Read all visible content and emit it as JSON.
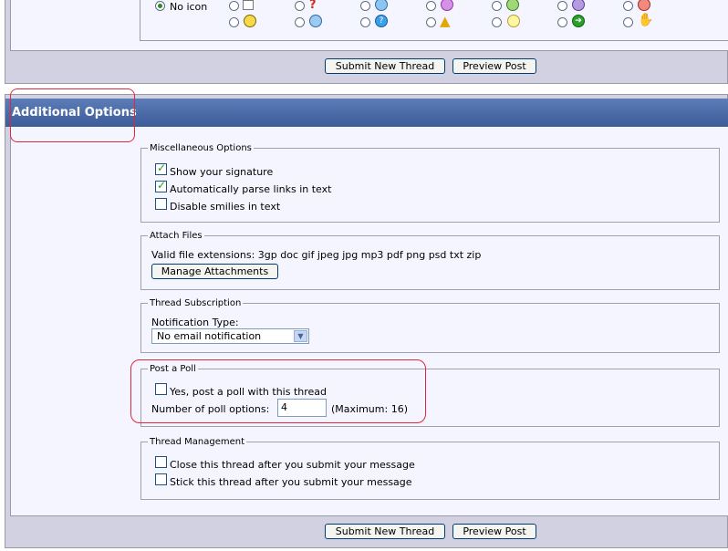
{
  "icons": {
    "no_icon_label": "No icon",
    "symbols": [
      "page-icon",
      "question-icon",
      "smile-icon",
      "grin-icon",
      "globe-icon",
      "sad-icon",
      "angry-icon",
      "happy-icon",
      "cool-icon",
      "question-circle-icon",
      "warning-icon",
      "lightbulb-icon",
      "arrow-icon",
      "thumbs-icon"
    ]
  },
  "buttons": {
    "submit": "Submit New Thread",
    "preview": "Preview Post"
  },
  "additional_options": {
    "title": "Additional Options"
  },
  "misc": {
    "legend": "Miscellaneous Options",
    "show_signature": "Show your signature",
    "parse_links": "Automatically parse links in text",
    "disable_smilies": "Disable smilies in text"
  },
  "attach": {
    "legend": "Attach Files",
    "extensions": "Valid file extensions: 3gp doc gif jpeg jpg mp3 pdf png psd txt zip",
    "manage": "Manage Attachments"
  },
  "subscription": {
    "legend": "Thread Subscription",
    "notification_label": "Notification Type:",
    "notification_value": "No email notification"
  },
  "poll": {
    "legend": "Post a Poll",
    "yes_label": "Yes, post a poll with this thread",
    "num_label": "Number of poll options:",
    "num_value": "4",
    "max_label": "(Maximum: 16)"
  },
  "management": {
    "legend": "Thread Management",
    "close": "Close this thread after you submit your message",
    "stick": "Stick this thread after you submit your message"
  },
  "colors": {
    "header": "#3b5c98",
    "panel": "#d1d1e1",
    "inner": "#f5f5ff",
    "highlight": "#e0283a"
  }
}
